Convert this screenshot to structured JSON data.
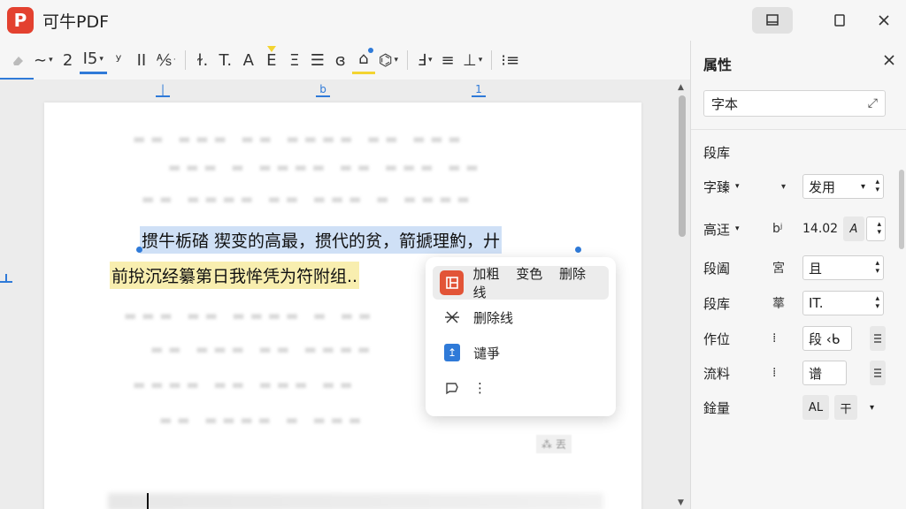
{
  "app": {
    "logo": "P",
    "title": "可牛PDF"
  },
  "window_controls": {
    "panel_toggle": "▭",
    "maximize": "☐",
    "close": "✕"
  },
  "toolbar": {
    "items": [
      "∼",
      "2",
      "Ⅰ5",
      "ʸ",
      "II",
      "⅍",
      "ɫ.",
      "T.",
      "A",
      "E",
      "Ξ",
      "☰",
      "ɞ",
      "⌂",
      "⌬",
      "Ⅎ",
      "≡",
      "⊥",
      "⁝≡"
    ]
  },
  "ruler": {
    "marks": [
      "|",
      "b",
      "1"
    ]
  },
  "document": {
    "line1": "掼牛栃䂿 猰变的高最，掼代的贫，箭搋理魡，廾",
    "line2": "前挩沉经纂第日我恈凭为符附组..",
    "page_tag": "⁂ 丟"
  },
  "context_menu": {
    "first_labels": [
      "加粗",
      "变色",
      "删除线"
    ],
    "item2_label": "删除线",
    "item3_label": "谴爭",
    "item4_label": "⋮"
  },
  "panel": {
    "title": "属性",
    "search_value": "字本",
    "section_title": "段库",
    "rows": [
      {
        "label": "字臻",
        "mid": "▾",
        "value": "发用"
      },
      {
        "label": "高迋",
        "mid": "bʲ",
        "value": "14.02"
      },
      {
        "label": "段阖",
        "mid": "宮",
        "value": "且"
      },
      {
        "label": "段库",
        "mid": "蕐",
        "value": "IT."
      },
      {
        "label": "作位",
        "mid": "⁞",
        "value": "段 ‹ᑲ"
      },
      {
        "label": "流料",
        "mid": "⁞",
        "value": "谱"
      },
      {
        "label": "鍂量",
        "mid": "",
        "value": ""
      }
    ],
    "row1_a_label": "A",
    "row7_btn1": "AL",
    "row7_btn2": "干"
  },
  "colors": {
    "accent": "#2f7ad8",
    "logo": "#e3412f",
    "selection": "#cfe0f6",
    "highlight": "#f8eeaf"
  }
}
